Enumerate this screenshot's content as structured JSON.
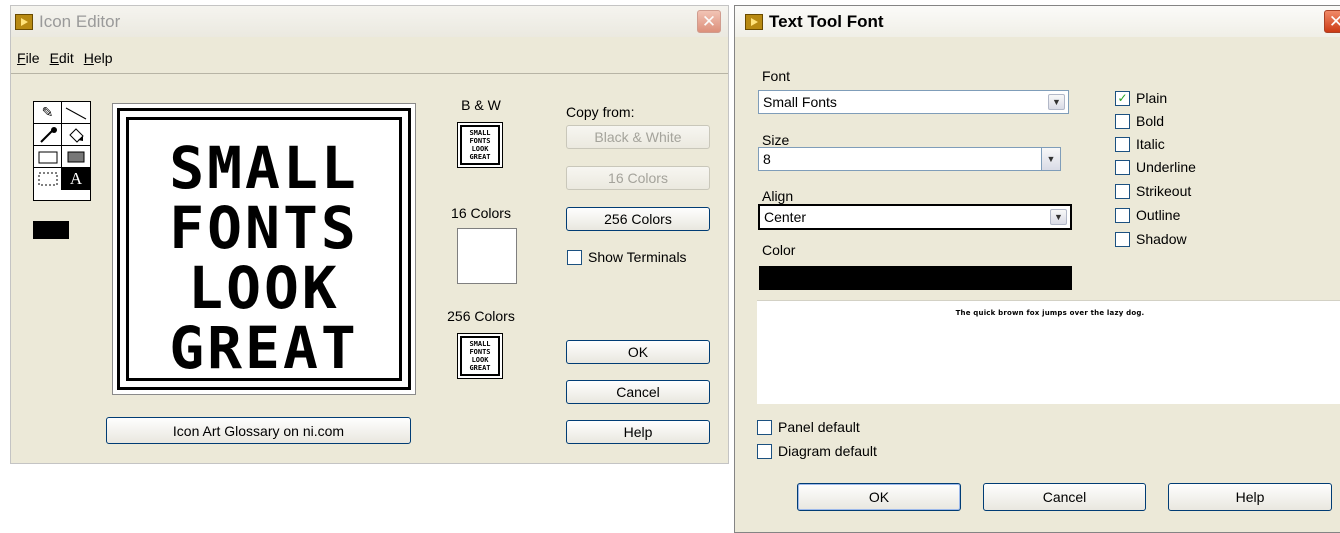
{
  "icon_editor": {
    "title": "Icon Editor",
    "menu": [
      "File",
      "Edit",
      "Help"
    ],
    "canvas_lines": [
      "SMALL",
      "FONTS",
      "LOOK",
      "GREAT"
    ],
    "mini_lines": [
      "SMALL",
      "FONTS",
      "LOOK",
      "GREAT"
    ],
    "labels": {
      "bw": "B & W",
      "sixteen": "16 Colors",
      "twofiftysix": "256 Colors",
      "copy_from": "Copy from:"
    },
    "copy_buttons": [
      "Black & White",
      "16 Colors",
      "256 Colors"
    ],
    "show_terminals": "Show Terminals",
    "ok": "OK",
    "cancel": "Cancel",
    "help": "Help",
    "glossary": "Icon Art Glossary on ni.com",
    "tool_a": "A"
  },
  "text_font": {
    "title": "Text Tool Font",
    "font_label": "Font",
    "font_value": "Small Fonts",
    "size_label": "Size",
    "size_value": "8",
    "align_label": "Align",
    "align_value": "Center",
    "color_label": "Color",
    "color_value": "#000000",
    "styles": [
      {
        "label": "Plain",
        "checked": true
      },
      {
        "label": "Bold",
        "checked": false
      },
      {
        "label": "Italic",
        "checked": false
      },
      {
        "label": "Underline",
        "checked": false
      },
      {
        "label": "Strikeout",
        "checked": false
      },
      {
        "label": "Outline",
        "checked": false
      },
      {
        "label": "Shadow",
        "checked": false
      }
    ],
    "preview_text": "The quick brown fox jumps over the lazy dog.",
    "panel_default": "Panel default",
    "diagram_default": "Diagram default",
    "ok": "OK",
    "cancel": "Cancel",
    "help": "Help"
  }
}
